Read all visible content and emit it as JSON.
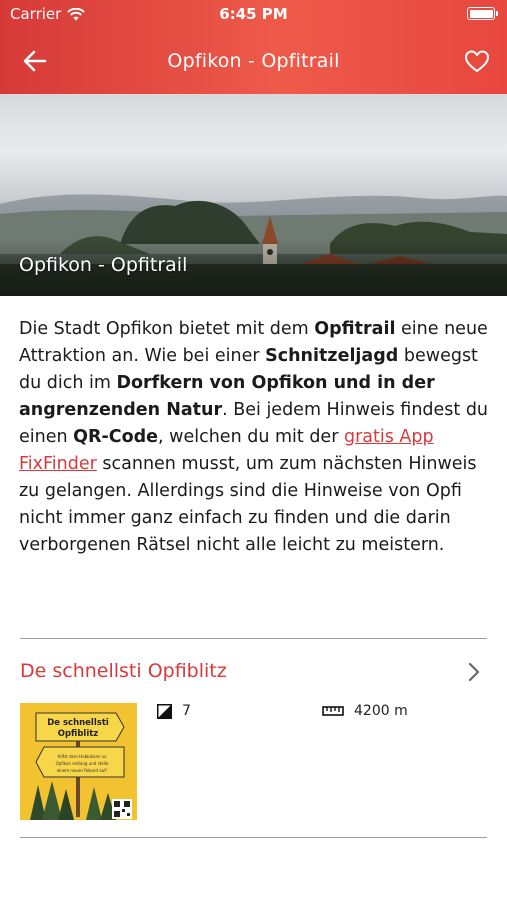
{
  "status_bar": {
    "carrier": "Carrier",
    "time": "6:45 PM"
  },
  "nav": {
    "title": "Opfikon - Opfitrail",
    "back_icon": "arrow-left-icon",
    "favorite_icon": "heart-icon"
  },
  "hero": {
    "title": "Opfikon - Opfitrail"
  },
  "description": {
    "p1": "Die Stadt Opfikon bietet mit dem ",
    "b1": "Opfitrail",
    "p2": " eine neue Attraktion an. Wie bei einer ",
    "b2": "Schnitzeljagd",
    "p3": " bewegst du dich im ",
    "b3": "Dorfkern von Opfikon und in der angrenzenden Natur",
    "p4": ". Bei jedem Hinweis findest du einen ",
    "b4": "QR-Code",
    "p5": ", welchen du mit der ",
    "link": "gratis App FixFinder",
    "p6": " scannen musst, um zum nächsten Hinweis zu gelangen. Allerdings sind die Hinweise von Opfi nicht immer ganz einfach zu finden und die darin verborgenen Rätsel nicht alle leicht zu meistern."
  },
  "trail": {
    "title": "De schnellsti Opfiblitz",
    "difficulty": "7",
    "length": "4200 m",
    "thumb_line1": "De schnellsti",
    "thumb_line2": "Opfiblitz",
    "thumb_small1": "Hilfst dem Hobbikomi vo",
    "thumb_small2": "Opfikon entlang und stelle",
    "thumb_small3": "einem neuen Rekord auf!"
  },
  "colors": {
    "accent": "#d9393b",
    "header": "#e8473e"
  }
}
